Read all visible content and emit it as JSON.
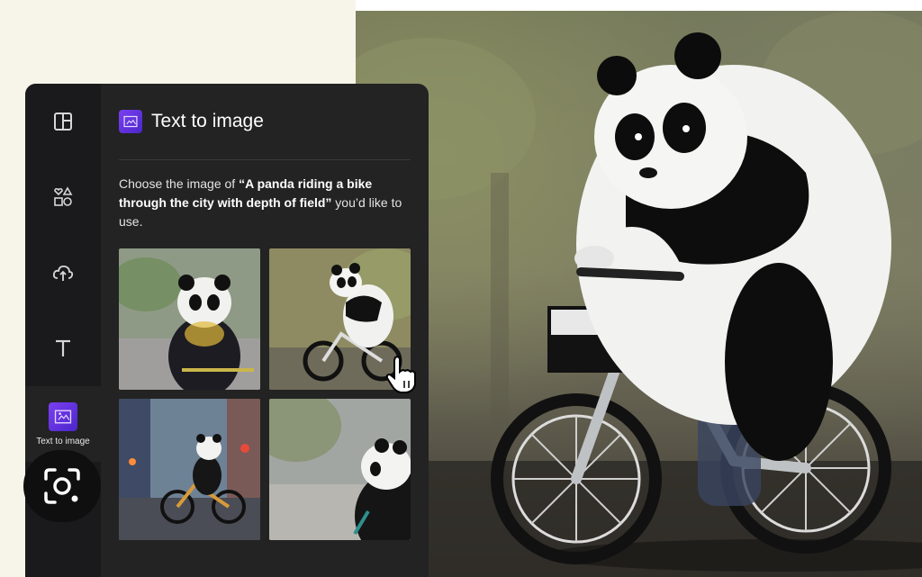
{
  "panel": {
    "title": "Text to image",
    "prompt_before": "Choose the image of ",
    "prompt_quoted": "“A panda riding a bike through the city with depth of field”",
    "prompt_after": " you’d like to use."
  },
  "rail": {
    "items": [
      {
        "icon": "layout-icon"
      },
      {
        "icon": "elements-icon"
      },
      {
        "icon": "upload-cloud-icon"
      },
      {
        "icon": "text-icon"
      },
      {
        "icon": "text-to-image-icon",
        "label": "Text to image",
        "active": true
      }
    ]
  },
  "thumbnails": [
    {
      "name": "panda-option-1"
    },
    {
      "name": "panda-option-2"
    },
    {
      "name": "panda-option-3"
    },
    {
      "name": "panda-option-4"
    }
  ],
  "colors": {
    "panel_bg": "#232323",
    "rail_bg": "#1a1a1c",
    "accent": "#7b3ff2",
    "page_bg": "#f7f4ea"
  },
  "overlay": {
    "lens_button_icon": "camera-lens-icon",
    "cursor_icon": "hand-pointer-icon"
  }
}
